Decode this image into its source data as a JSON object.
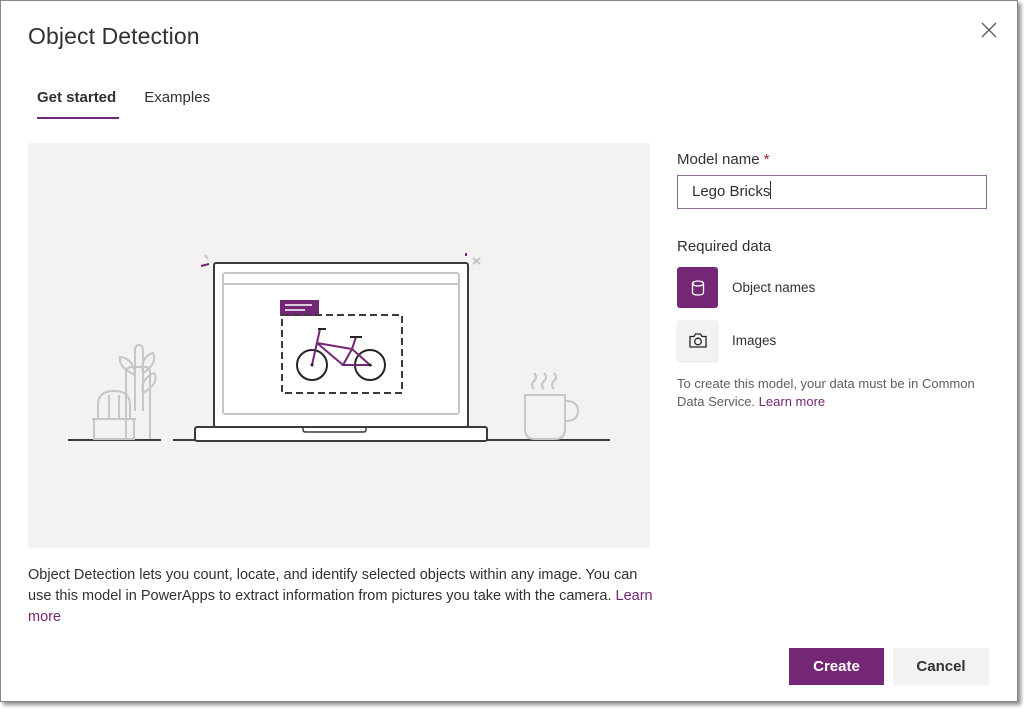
{
  "dialog": {
    "title": "Object Detection",
    "close_icon": "close-icon"
  },
  "tabs": [
    {
      "label": "Get started",
      "active": true
    },
    {
      "label": "Examples",
      "active": false
    }
  ],
  "illustration": {
    "description": "Laptop showing a bicycle inside a dashed detection bounding box with a purple label tag; cactus plant on the left, steaming mug on the right",
    "accent_color": "#742774"
  },
  "description": {
    "text": "Object Detection lets you count, locate, and identify selected objects within any image. You can use this model in PowerApps to extract information from pictures you take with the camera.",
    "link": "Learn more"
  },
  "form": {
    "model_name_label": "Model name",
    "required_marker": "*",
    "model_name_value": "Lego Bricks",
    "required_data_label": "Required data",
    "items": [
      {
        "label": "Object names",
        "icon": "database-icon"
      },
      {
        "label": "Images",
        "icon": "camera-icon"
      }
    ],
    "note_text": "To create this model, your data must be in Common Data Service.",
    "note_link": "Learn more"
  },
  "buttons": {
    "create": "Create",
    "cancel": "Cancel"
  },
  "colors": {
    "accent": "#742774",
    "required": "#a4262c",
    "illustration_bg": "#f3f2f1"
  }
}
